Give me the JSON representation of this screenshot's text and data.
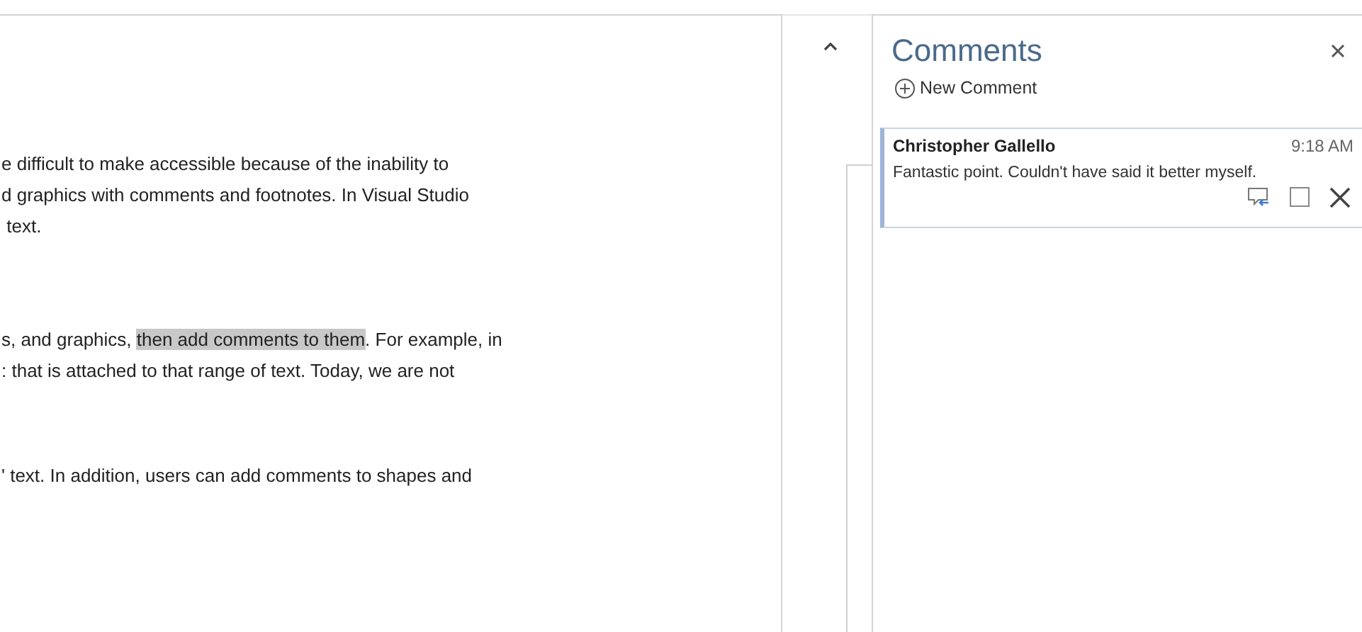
{
  "document": {
    "paragraphs": [
      {
        "lines": [
          [
            {
              "text": "e difficult to make accessible because of the inability to",
              "highlighted": false
            }
          ],
          [
            {
              "text": "d graphics with comments and footnotes. In Visual Studio",
              "highlighted": false
            }
          ],
          [
            {
              "text": " text.",
              "highlighted": false
            }
          ]
        ]
      },
      {
        "lines": [
          [
            {
              "text": "s, and graphics, ",
              "highlighted": false
            },
            {
              "text": "then add comments to them",
              "highlighted": true
            },
            {
              "text": ". For example, in",
              "highlighted": false
            }
          ],
          [
            {
              "text": ": that is attached to that range of text. Today, we are not",
              "highlighted": false
            }
          ]
        ]
      },
      {
        "lines": [
          [
            {
              "text": "' text. In addition, users can add comments to shapes and",
              "highlighted": false
            }
          ]
        ]
      }
    ]
  },
  "comments_pane": {
    "title": "Comments",
    "new_comment": "New Comment",
    "comments": [
      {
        "author": "Christopher Gallello",
        "time": "9:18 AM",
        "text": "Fantastic point. Couldn't have said it better myself.",
        "selected": true,
        "done": false
      }
    ]
  }
}
